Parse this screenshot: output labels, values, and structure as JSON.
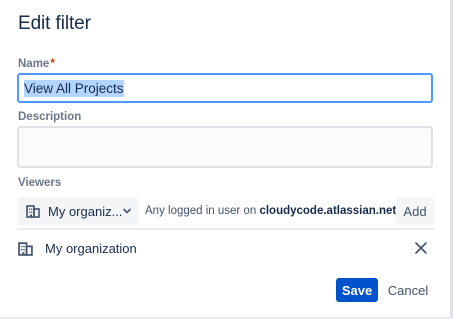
{
  "dialog": {
    "title": "Edit filter"
  },
  "form": {
    "name_label": "Name",
    "required_marker": "*",
    "name_value": "View All Projects",
    "description_label": "Description",
    "description_value": "",
    "viewers_label": "Viewers"
  },
  "viewers": {
    "select_icon": "building-icon",
    "select_value": "My organiz...",
    "chevron_icon": "chevron-down-icon",
    "note_prefix": "Any logged in user on",
    "note_domain": "cloudycode.atlassian.net",
    "add_label": "Add",
    "items": [
      {
        "icon": "building-icon",
        "label": "My organization",
        "remove_icon": "close-icon"
      }
    ]
  },
  "footer": {
    "save_label": "Save",
    "cancel_label": "Cancel"
  },
  "colors": {
    "primary": "#0052cc",
    "focus_border": "#4c9aff",
    "required": "#de350b",
    "text": "#172b4d",
    "muted": "#6b778c"
  }
}
